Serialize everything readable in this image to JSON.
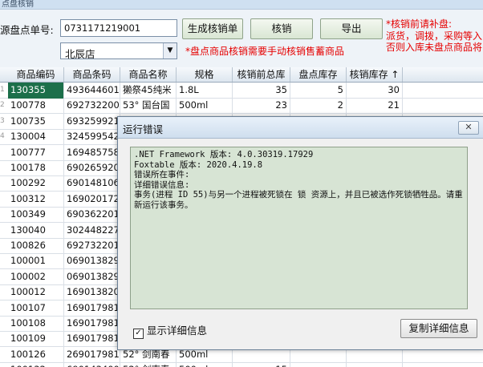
{
  "window": {
    "title_fragment": "点盘核销"
  },
  "form": {
    "order_label": "源盘点单号:",
    "order_value": "0731171219001",
    "store_value": "北辰店",
    "buttons": {
      "generate": "生成核销单",
      "writeoff": "核销",
      "export": "导出"
    },
    "note_top": "*核销前请补盘:",
    "note_lines": [
      "派货，调拨，采购等入",
      "否则入库未盘点商品将"
    ],
    "note_bottom": "*盘点商品核销需要手动核销售蓄商品"
  },
  "grid": {
    "columns": [
      "商品编码",
      "商品条码",
      "商品名称",
      "规格",
      "核销前总库",
      "盘点库存",
      "核销库存 ↑"
    ],
    "rows": [
      [
        "130355",
        "4936446010",
        "獭祭45纯米",
        "1.8L",
        "35",
        "5",
        "30"
      ],
      [
        "100778",
        "6927322008",
        "53° 国台国",
        "500ml",
        "23",
        "2",
        "21"
      ],
      [
        "100735",
        "6932599213",
        "",
        "",
        "",
        "",
        ""
      ],
      [
        "130004",
        "3245995426",
        "",
        "",
        "",
        "",
        ""
      ],
      [
        "100777",
        "1694857580",
        "",
        "",
        "",
        "",
        ""
      ],
      [
        "100178",
        "6902659201",
        "",
        "",
        "",
        "",
        ""
      ],
      [
        "100292",
        "6901481065",
        "",
        "",
        "",
        "",
        ""
      ],
      [
        "100312",
        "1690201720",
        "",
        "",
        "",
        "",
        ""
      ],
      [
        "100349",
        "6903622013",
        "",
        "",
        "",
        "",
        ""
      ],
      [
        "130040",
        "3024482270",
        "",
        "",
        "",
        "",
        ""
      ],
      [
        "100826",
        "6927322010",
        "",
        "",
        "",
        "",
        ""
      ],
      [
        "100001",
        "0690138290",
        "",
        "",
        "",
        "",
        ""
      ],
      [
        "100002",
        "0690138292",
        "",
        "",
        "",
        "",
        ""
      ],
      [
        "100012",
        "1690138200",
        "",
        "",
        "",
        "",
        ""
      ],
      [
        "100107",
        "1690179813",
        "",
        "",
        "",
        "",
        ""
      ],
      [
        "100108",
        "1690179813",
        "",
        "",
        "",
        "",
        ""
      ],
      [
        "100109",
        "1690179819",
        "",
        "",
        "",
        "",
        ""
      ],
      [
        "100126",
        "2690179810",
        "52° 剑南春",
        "500ml",
        "",
        "",
        ""
      ],
      [
        "100132",
        "6901434004",
        "52° 剑南春",
        "500ml",
        "15",
        "",
        ""
      ]
    ],
    "row_marks": [
      "1",
      "2",
      "3",
      "4"
    ]
  },
  "dialog": {
    "title": "运行错误",
    "close": "✕",
    "message": [
      ".NET Framework 版本: 4.0.30319.17929",
      "Foxtable 版本: 2020.4.19.8",
      "错误所在事件:",
      "详细错误信息:",
      "事务(进程 ID 55)与另一个进程被死锁在 锁 资源上，并且已被选作死锁牺牲品。请重新运行该事务。"
    ],
    "checkbox_label": "显示详细信息",
    "copy_button": "复制详细信息"
  }
}
